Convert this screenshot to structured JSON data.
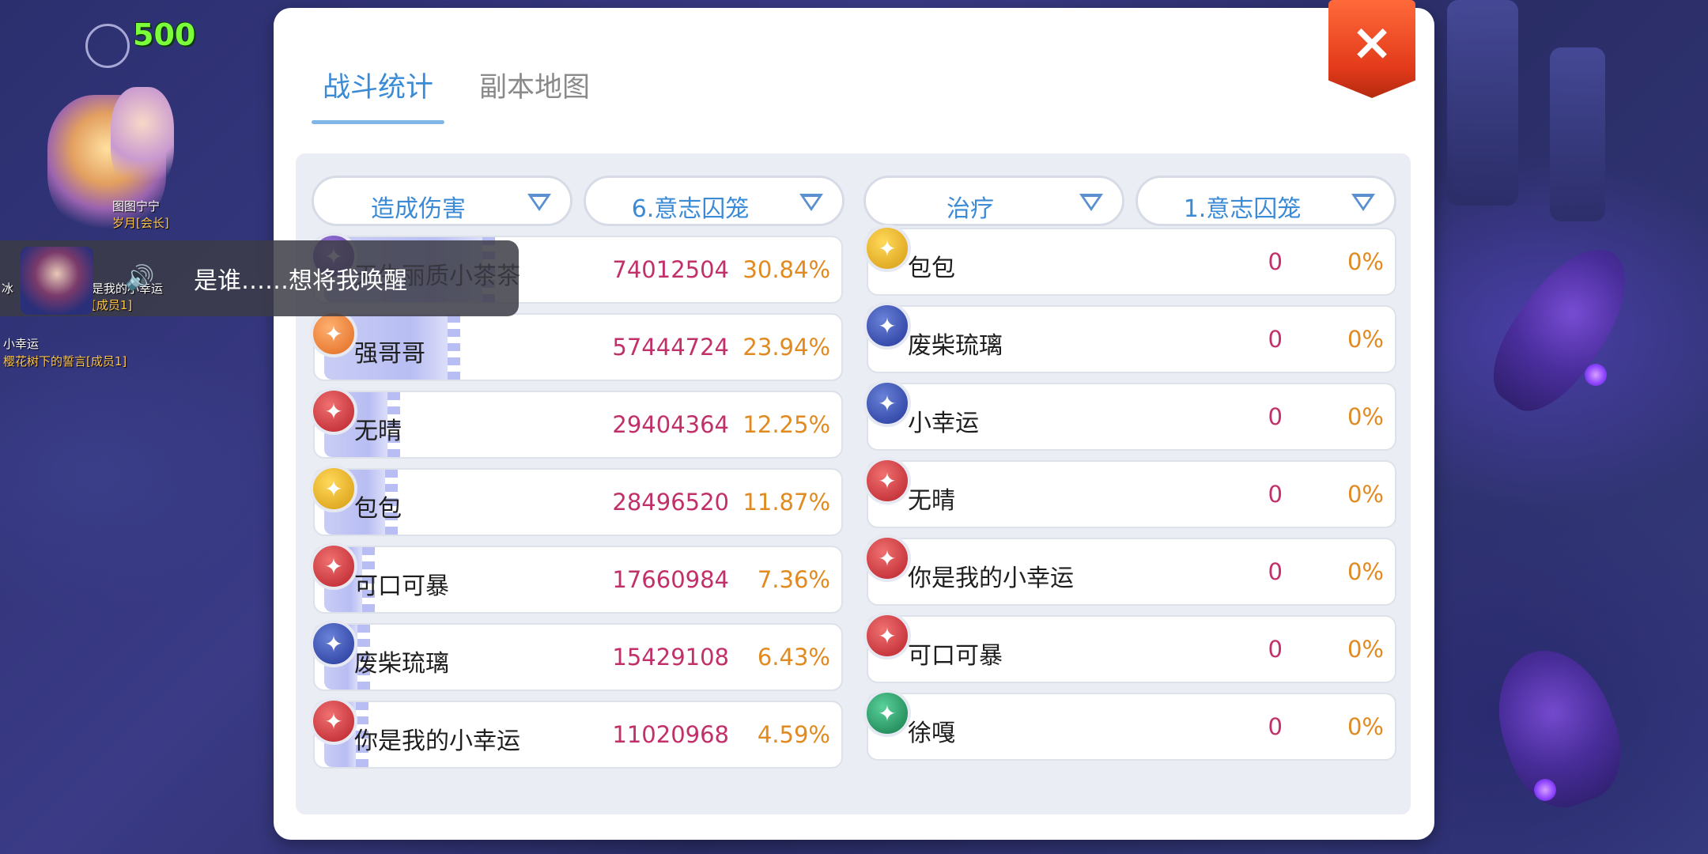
{
  "hud": {
    "score": "500",
    "players": [
      {
        "name": "图图宁宁",
        "guild": "岁月[会长]"
      },
      {
        "name": "是我的小幸运",
        "guild": "[成员1]"
      },
      {
        "name": "小幸运",
        "guild": "樱花树下的誓言[成员1]"
      }
    ],
    "partial_name": "冰"
  },
  "dialog": {
    "text": "是谁……想将我唤醒"
  },
  "panel": {
    "tabs": [
      {
        "label": "战斗统计",
        "active": true
      },
      {
        "label": "副本地图",
        "active": false
      }
    ],
    "close_label": "×"
  },
  "left_table": {
    "metric_dropdown": "造成伤害",
    "scope_dropdown": "6.意志囚笼",
    "rows": [
      {
        "name": "天生丽质小茶茶",
        "value": "74012504",
        "percent": "30.84%",
        "fraction": 0.3084,
        "icon": "purple-class-icon",
        "class_color": "#5a3aa0"
      },
      {
        "name": "强哥哥",
        "value": "57444724",
        "percent": "23.94%",
        "fraction": 0.2394,
        "icon": "orange-class-icon",
        "class_color": "#e06a20"
      },
      {
        "name": "无晴",
        "value": "29404364",
        "percent": "12.25%",
        "fraction": 0.1225,
        "icon": "red-class-icon",
        "class_color": "#b8222a"
      },
      {
        "name": "包包",
        "value": "28496520",
        "percent": "11.87%",
        "fraction": 0.1187,
        "icon": "gold-class-icon",
        "class_color": "#d69a10"
      },
      {
        "name": "可口可暴",
        "value": "17660984",
        "percent": "7.36%",
        "fraction": 0.0736,
        "icon": "red-class-icon",
        "class_color": "#b8222a"
      },
      {
        "name": "废柴琉璃",
        "value": "15429108",
        "percent": "6.43%",
        "fraction": 0.0643,
        "icon": "blue-class-icon",
        "class_color": "#23379a"
      },
      {
        "name": "你是我的小幸运",
        "value": "11020968",
        "percent": "4.59%",
        "fraction": 0.0459,
        "icon": "red-class-icon",
        "class_color": "#b8222a"
      }
    ]
  },
  "right_table": {
    "metric_dropdown": "治疗",
    "scope_dropdown": "1.意志囚笼",
    "rows": [
      {
        "name": "包包",
        "value": "0",
        "percent": "0%",
        "icon": "gold-class-icon"
      },
      {
        "name": "废柴琉璃",
        "value": "0",
        "percent": "0%",
        "icon": "blue-class-icon"
      },
      {
        "name": "小幸运",
        "value": "0",
        "percent": "0%",
        "icon": "blue-class-icon"
      },
      {
        "name": "无晴",
        "value": "0",
        "percent": "0%",
        "icon": "red-class-icon"
      },
      {
        "name": "你是我的小幸运",
        "value": "0",
        "percent": "0%",
        "icon": "red-class-icon"
      },
      {
        "name": "可口可暴",
        "value": "0",
        "percent": "0%",
        "icon": "red-class-icon"
      },
      {
        "name": "徐嘎",
        "value": "0",
        "percent": "0%",
        "icon": "green-class-icon"
      }
    ]
  },
  "colors": {
    "accent": "#3a8ad6",
    "value": "#c2306a",
    "percent": "#e08a20",
    "close": "#e23a1a"
  }
}
